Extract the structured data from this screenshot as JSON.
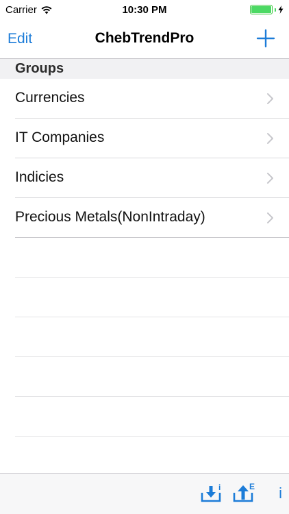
{
  "status_bar": {
    "carrier": "Carrier",
    "time": "10:30 PM",
    "wifi_icon": "wifi-icon",
    "battery_icon": "battery-icon",
    "charging_icon": "charging-bolt-icon"
  },
  "nav": {
    "edit_label": "Edit",
    "title": "ChebTrendPro",
    "add_icon": "plus-icon"
  },
  "section": {
    "header": "Groups"
  },
  "groups": [
    {
      "label": "Currencies"
    },
    {
      "label": "IT Companies"
    },
    {
      "label": "Indicies"
    },
    {
      "label": "Precious Metals(NonIntraday)"
    }
  ],
  "toolbar": {
    "import_icon": "import-download-icon",
    "import_badge": "i",
    "export_icon": "export-upload-icon",
    "export_badge": "E",
    "info_label": "i"
  },
  "colors": {
    "accent": "#1c7cd8",
    "battery": "#4cd964",
    "separator": "#c8c7cc",
    "section_bg": "#f1f1f3"
  }
}
